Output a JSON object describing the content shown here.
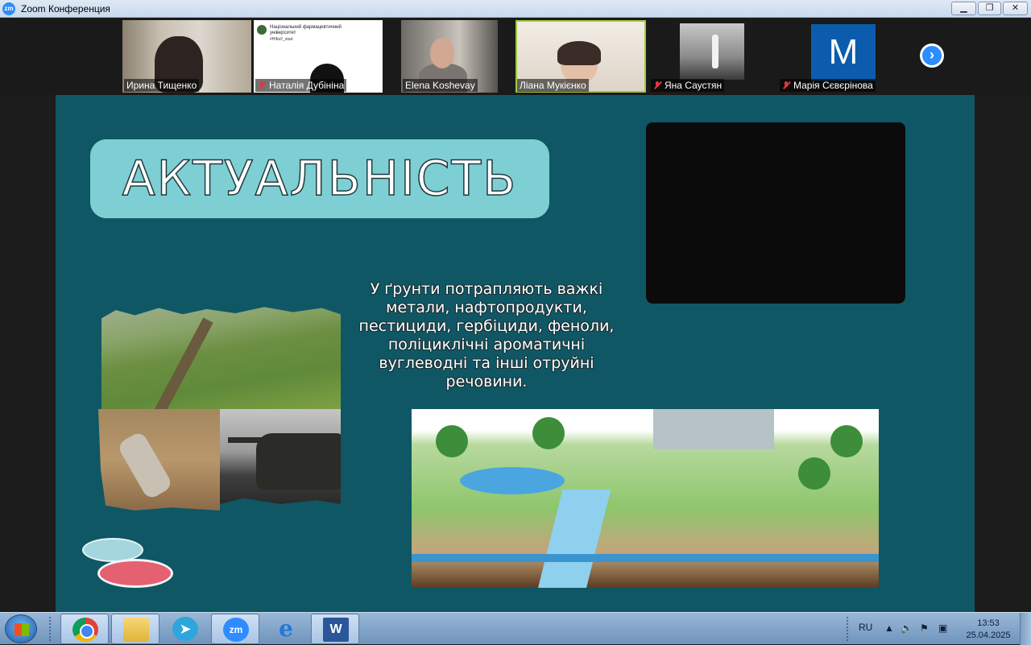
{
  "window": {
    "app_icon": "zm",
    "title": "Zoom Конференция",
    "controls": {
      "minimize": "▁",
      "maximize": "❐",
      "close": "✕"
    }
  },
  "participants": [
    {
      "name": "Ирина Тищенко",
      "muted": false,
      "active": false
    },
    {
      "name": "Наталія Дубініна",
      "muted": true,
      "active": false
    },
    {
      "name": "Elena Koshevay",
      "muted": false,
      "active": false
    },
    {
      "name": "Ліана Мукієнко",
      "muted": false,
      "active": true
    },
    {
      "name": "Яна Саустян",
      "muted": true,
      "active": false
    },
    {
      "name": "Марія Сєвєрінова",
      "muted": true,
      "active": false,
      "avatar_letter": "M"
    }
  ],
  "shared_screen": {
    "university_header": "Національний фармацевтичний університет",
    "university_hashtag": "#НФаУ_start"
  },
  "next_page_arrow": "›",
  "slide": {
    "title": "АКТУАЛЬНІСТЬ",
    "body": "У ґрунти потрапляють важкі метали, нафтопродукти, пестициди, гербіциди, феноли, поліциклічні ароматичні вуглеводні та інші отруйні речовини."
  },
  "taskbar": {
    "apps": [
      {
        "name": "chrome-icon",
        "label": ""
      },
      {
        "name": "folder-icon",
        "label": ""
      },
      {
        "name": "telegram-icon",
        "label": "➤"
      },
      {
        "name": "zoom-icon",
        "label": "zm"
      },
      {
        "name": "internet-explorer-icon",
        "label": "e"
      },
      {
        "name": "word-icon",
        "label": "W"
      }
    ],
    "language": "RU",
    "time": "13:53",
    "date": "25.04.2025"
  },
  "colors": {
    "slide_bg": "#0f5765",
    "title_pill": "#7ecfd3",
    "zoom_blue": "#2d8cff",
    "active_speaker": "#9ecb3b",
    "muted_red": "#e0383e"
  }
}
